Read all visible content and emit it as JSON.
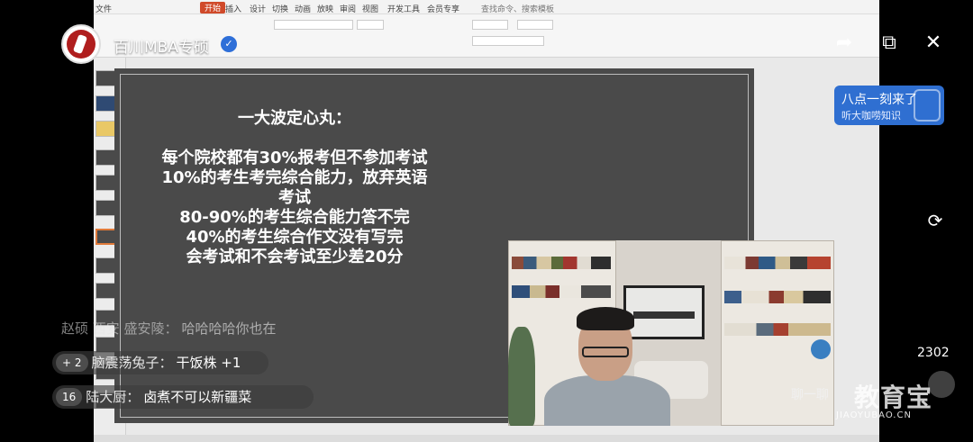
{
  "stream": {
    "channel_name": "百川MBA专硕",
    "verified_icon": "verified-check-icon",
    "viewer_count": "2302",
    "chat_hint": "聊一聊"
  },
  "promo": {
    "title": "八点一刻来了",
    "subtitle": "听大咖唠知识"
  },
  "app": {
    "menu": [
      "文件",
      "开始",
      "插入",
      "设计",
      "切换",
      "动画",
      "放映",
      "审阅",
      "视图",
      "开发工具",
      "会员专享"
    ],
    "active_menu": "开始",
    "search_placeholder": "查找命令、搜索模板"
  },
  "slide": {
    "title": "一大波定心丸：",
    "lines": [
      "每个院校都有30%报考但不参加考试",
      "10%的考生考完综合能力，放弃英语",
      "考试",
      "80-90%的考生综合能力答不完",
      "40%的考生综合作文没有写完",
      "会考试和不会考试至少差20分"
    ]
  },
  "chat": [
    {
      "badge": "",
      "user": "赵硕 西安 盛安陵：",
      "text": "哈哈哈哈你也在"
    },
    {
      "badge": "+ 2",
      "user": "脑震荡兔子：",
      "text": "干饭株 +1"
    },
    {
      "badge": "16",
      "user": "陆大厨：",
      "text": "卤煮不可以新疆菜"
    }
  ],
  "watermark": {
    "big": "教育宝",
    "small": "JIAOYUBAO.CN"
  },
  "colors": {
    "accent_red": "#d04a2a",
    "promo_blue": "#2f6fd1",
    "slide_bg": "#4a4a4a"
  }
}
